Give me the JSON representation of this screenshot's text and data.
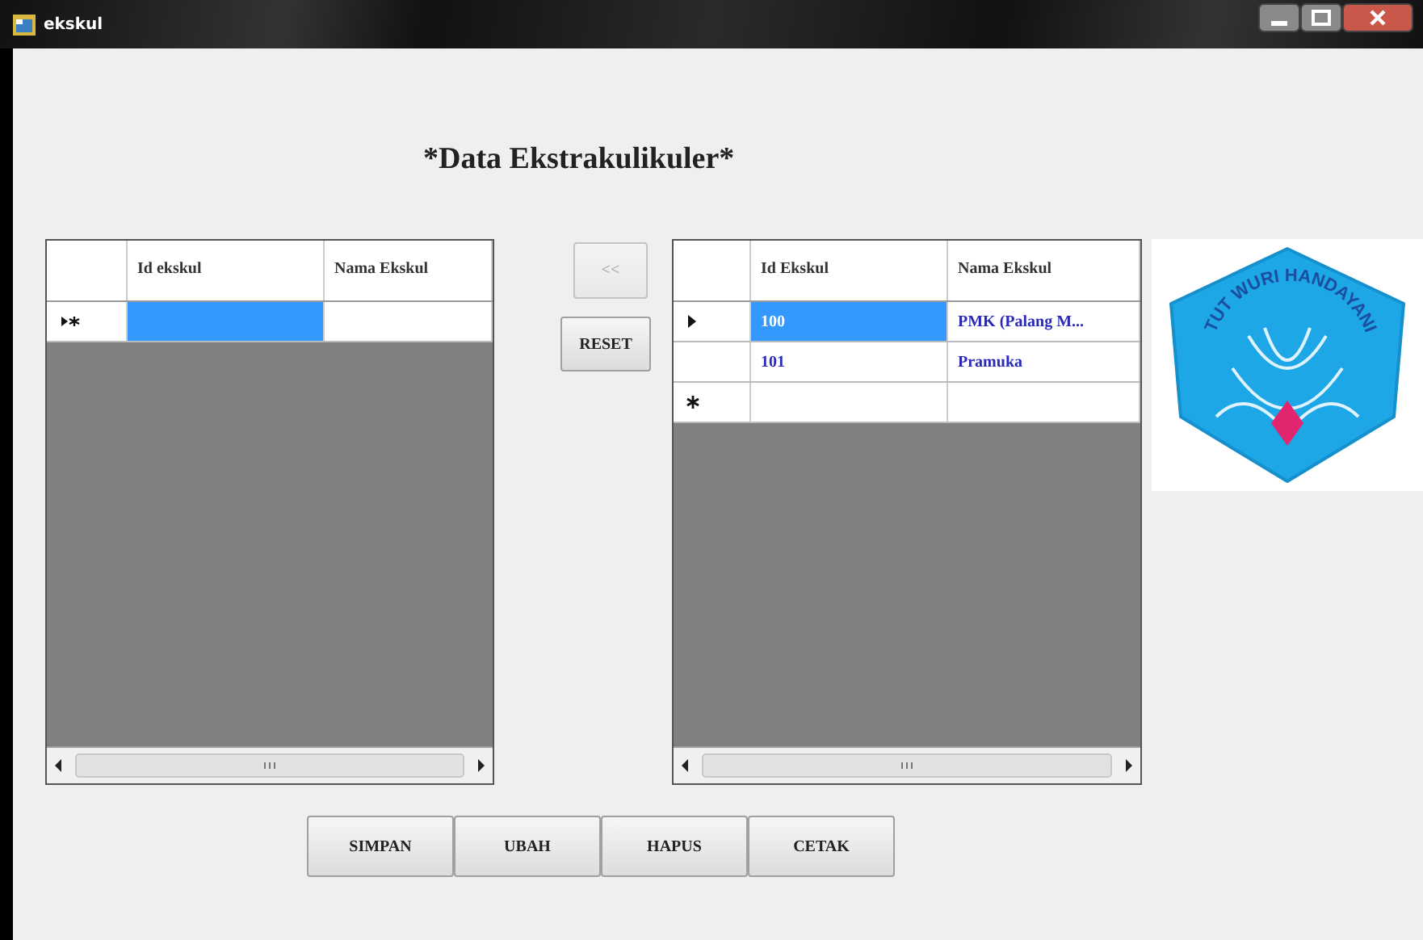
{
  "window": {
    "title": "ekskul"
  },
  "heading": "*Data Ekstrakulikuler*",
  "grids": [
    {
      "columns": [
        "Id ekskul",
        "Nama Ekskul"
      ],
      "rows": [
        {
          "kind": "current-new",
          "cells": [
            {
              "selected": true
            },
            {
              "selected": false
            }
          ]
        }
      ]
    },
    {
      "columns": [
        "Id Ekskul",
        "Nama Ekskul"
      ],
      "rows": [
        {
          "kind": "current",
          "cells": [
            {
              "text": "100",
              "selected": true
            },
            {
              "text": "PMK (Palang M...",
              "selected": false
            }
          ]
        },
        {
          "kind": "plain",
          "cells": [
            {
              "text": "101",
              "selected": false
            },
            {
              "text": "Pramuka",
              "selected": false
            }
          ]
        },
        {
          "kind": "new",
          "cells": [
            {
              "selected": false
            },
            {
              "selected": false
            }
          ]
        }
      ]
    }
  ],
  "side_buttons": [
    {
      "label": "<<",
      "disabled": true
    },
    {
      "label": "RESET",
      "disabled": false
    }
  ],
  "logo": {
    "motto": "TUT WURI HANDAYANI"
  },
  "bottom_buttons": [
    {
      "label": "SIMPAN"
    },
    {
      "label": "UBAH"
    },
    {
      "label": "HAPUS"
    },
    {
      "label": "CETAK"
    }
  ]
}
